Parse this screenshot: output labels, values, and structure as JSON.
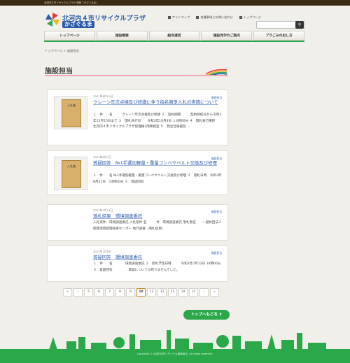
{
  "topbar": {
    "text": "北河内４市リサイクルプラザ 愛称「かざぐるま」"
  },
  "logo": {
    "title": "北河内４市リサイクルプラザ",
    "nickname": "かざぐるま"
  },
  "util": {
    "sitemap": "サイトマップ",
    "contact": "各種事項とお問い合わせ",
    "top": "トップページ"
  },
  "nav": [
    "トップページ",
    "施設概要",
    "組合運営",
    "施設見学のご案内",
    "プラごみの出し方"
  ],
  "breadcrumb": {
    "home": "トップページ",
    "sep": "＞",
    "current": "施設担当"
  },
  "page_title": "施設担当",
  "posts": [
    {
      "date": "2021年8月10日",
      "category": "施設担当",
      "title": "クレーン年次点検及び修繕に伴う指名競争入札の実施について",
      "body": "１　件　　名　　　クレーン年次点検及び修繕 ２　契約期間　　　契約締結日から令和3年12月15日まで ３　開札執行日　　令和3年10月4日 １4時00分 ４　開札執行場所　　北河内４市リサイクルプラザ管理棟1階事務室 ５　発注仕様書及 ...",
      "thumb": "入札箱"
    },
    {
      "date": "2021年8月7日",
      "category": "施設担当",
      "title": "質疑回答　№1手選別軽量・重量コンベヤベルト交換及び修理",
      "body": "１　件　　名 №1手選別軽量・重量コンベヤベルト交換及び修理 ２　開札日時　令和3年8月21日　14時00分 ３　質疑回答",
      "thumb": "入札箱"
    },
    {
      "date": "2021年7月14日",
      "category": "施設担当",
      "title": "落札結果　環境調査委託",
      "body": "入札案件：環境調査委託 入札案件 名　　　件　環境調査委託 落札者名　　一般財団法人　関西環境管理技術センター 執行調書（落札結果）"
    },
    {
      "date": "2021年7月5日",
      "category": "施設担当",
      "title": "質疑回答　環境調査委託",
      "body": "１　件　　名　　　　環境調査委託 ２　開札予定日時　　　令和3年7月12日 14時00分 ３　質疑回答　　　　　質疑については有りませんでした。"
    }
  ],
  "pager": [
    "«",
    "‹",
    "5",
    "6",
    "7",
    "8",
    "9",
    "10",
    "11",
    "12",
    "13",
    "14",
    "15",
    "›",
    "»"
  ],
  "pager_current": "10",
  "totop": "トップへもどる",
  "copyright": "Copyright © 北河内4市リサイクル施設組合. All rights reserved."
}
